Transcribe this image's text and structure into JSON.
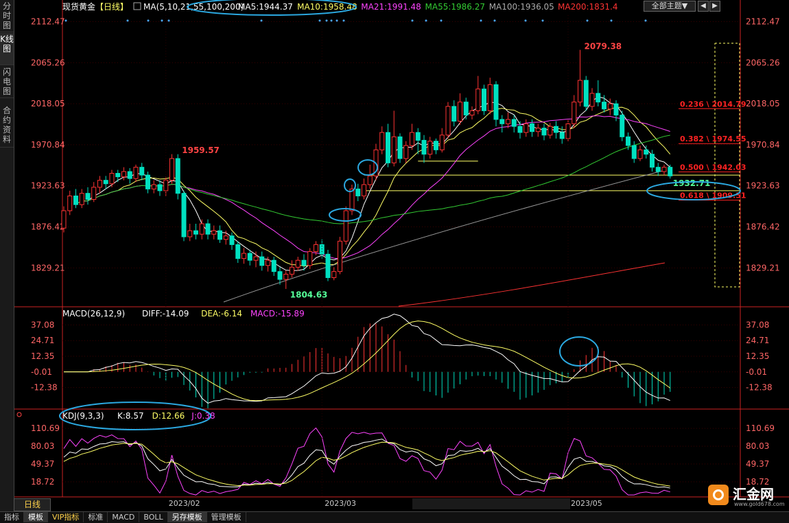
{
  "sidebar": {
    "tabs": [
      "分时图",
      "K线图",
      "闪电图",
      "合约资料"
    ]
  },
  "header": {
    "instrument": "现货黄金",
    "period": "【日线】",
    "ma_label": "MA(5,10,21,55,100,200)",
    "ma_values": [
      {
        "text": "MA5:1944.37",
        "color": "#ffffff"
      },
      {
        "text": "MA10:1958.48",
        "color": "#ffff66"
      },
      {
        "text": "MA21:1991.48",
        "color": "#ff44ff"
      },
      {
        "text": "MA55:1986.27",
        "color": "#33cc33"
      },
      {
        "text": "MA100:1936.05",
        "color": "#aaaaaa"
      },
      {
        "text": "MA200:1831.4",
        "color": "#ff3333"
      }
    ],
    "theme_button": "全部主题▼",
    "prev": "◀",
    "next": "▶"
  },
  "colors": {
    "up": "#ff3333",
    "down": "#00e0c0",
    "grid": "#3a0000",
    "axis": "#cc2222",
    "fib": "#ff2222"
  },
  "chart_data": {
    "type": "candlestick",
    "price_axis": [
      "2112.47",
      "2065.26",
      "2018.05",
      "1970.84",
      "1923.63",
      "1876.42",
      "1829.21"
    ],
    "x_ticks": [
      "2023/02",
      "2023/03",
      "2023/05"
    ],
    "price_range": [
      1790,
      2120
    ],
    "candles": [
      [
        1875,
        1895,
        1870,
        1900
      ],
      [
        1895,
        1912,
        1890,
        1918
      ],
      [
        1912,
        1902,
        1898,
        1920
      ],
      [
        1902,
        1915,
        1898,
        1920
      ],
      [
        1915,
        1908,
        1902,
        1922
      ],
      [
        1908,
        1922,
        1905,
        1928
      ],
      [
        1922,
        1930,
        1915,
        1935
      ],
      [
        1930,
        1926,
        1920,
        1935
      ],
      [
        1926,
        1938,
        1922,
        1942
      ],
      [
        1938,
        1934,
        1928,
        1942
      ],
      [
        1934,
        1940,
        1930,
        1945
      ],
      [
        1940,
        1932,
        1926,
        1944
      ],
      [
        1932,
        1945,
        1928,
        1948
      ],
      [
        1945,
        1936,
        1930,
        1950
      ],
      [
        1936,
        1920,
        1915,
        1940
      ],
      [
        1920,
        1925,
        1915,
        1930
      ],
      [
        1925,
        1918,
        1912,
        1930
      ],
      [
        1918,
        1930,
        1912,
        1934
      ],
      [
        1930,
        1955,
        1926,
        1960
      ],
      [
        1955,
        1915,
        1908,
        1960
      ],
      [
        1915,
        1865,
        1860,
        1918
      ],
      [
        1865,
        1872,
        1860,
        1880
      ],
      [
        1872,
        1868,
        1862,
        1880
      ],
      [
        1868,
        1880,
        1862,
        1885
      ],
      [
        1880,
        1868,
        1862,
        1885
      ],
      [
        1868,
        1872,
        1862,
        1878
      ],
      [
        1872,
        1862,
        1858,
        1878
      ],
      [
        1862,
        1866,
        1856,
        1872
      ],
      [
        1866,
        1856,
        1850,
        1870
      ],
      [
        1856,
        1840,
        1835,
        1860
      ],
      [
        1840,
        1846,
        1834,
        1852
      ],
      [
        1846,
        1838,
        1832,
        1850
      ],
      [
        1838,
        1842,
        1830,
        1848
      ],
      [
        1842,
        1832,
        1826,
        1848
      ],
      [
        1832,
        1838,
        1825,
        1842
      ],
      [
        1838,
        1825,
        1820,
        1842
      ],
      [
        1825,
        1816,
        1810,
        1830
      ],
      [
        1816,
        1822,
        1805,
        1826
      ],
      [
        1822,
        1830,
        1818,
        1838
      ],
      [
        1830,
        1838,
        1826,
        1842
      ],
      [
        1838,
        1832,
        1826,
        1845
      ],
      [
        1832,
        1848,
        1828,
        1852
      ],
      [
        1848,
        1856,
        1844,
        1860
      ],
      [
        1856,
        1845,
        1840,
        1862
      ],
      [
        1845,
        1818,
        1814,
        1850
      ],
      [
        1818,
        1825,
        1815,
        1830
      ],
      [
        1825,
        1860,
        1822,
        1865
      ],
      [
        1860,
        1895,
        1856,
        1900
      ],
      [
        1895,
        1920,
        1890,
        1925
      ],
      [
        1920,
        1912,
        1906,
        1926
      ],
      [
        1912,
        1925,
        1908,
        1932
      ],
      [
        1925,
        1935,
        1920,
        1948
      ],
      [
        1935,
        1965,
        1930,
        1972
      ],
      [
        1965,
        1985,
        1960,
        1992
      ],
      [
        1985,
        1950,
        1945,
        1995
      ],
      [
        1950,
        1980,
        1946,
        2010
      ],
      [
        1980,
        1955,
        1950,
        1984
      ],
      [
        1955,
        1970,
        1950,
        1975
      ],
      [
        1970,
        1985,
        1965,
        1995
      ],
      [
        1985,
        1976,
        1960,
        1990
      ],
      [
        1976,
        1960,
        1950,
        1982
      ],
      [
        1960,
        1975,
        1955,
        1980
      ],
      [
        1975,
        1965,
        1960,
        1978
      ],
      [
        1965,
        1982,
        1962,
        1990
      ],
      [
        1982,
        2015,
        1978,
        2020
      ],
      [
        2015,
        1998,
        1992,
        2022
      ],
      [
        1998,
        2020,
        1994,
        2030
      ],
      [
        2020,
        2005,
        2000,
        2025
      ],
      [
        2005,
        2010,
        2000,
        2015
      ],
      [
        2010,
        2035,
        2006,
        2050
      ],
      [
        2035,
        2010,
        2005,
        2040
      ],
      [
        2010,
        2040,
        2006,
        2048
      ],
      [
        2040,
        2000,
        1992,
        2044
      ],
      [
        2000,
        1995,
        1985,
        2005
      ],
      [
        1995,
        2000,
        1990,
        2008
      ],
      [
        2000,
        1992,
        1985,
        2005
      ],
      [
        1992,
        1985,
        1978,
        1998
      ],
      [
        1985,
        1995,
        1980,
        2000
      ],
      [
        1995,
        1986,
        1980,
        2000
      ],
      [
        1986,
        1990,
        1980,
        1995
      ],
      [
        1990,
        1982,
        1976,
        1995
      ],
      [
        1982,
        1992,
        1978,
        1996
      ],
      [
        1992,
        1985,
        1978,
        1998
      ],
      [
        1985,
        1978,
        1972,
        1992
      ],
      [
        1978,
        1995,
        1975,
        2000
      ],
      [
        1995,
        2020,
        1990,
        2028
      ],
      [
        2020,
        2045,
        2015,
        2080
      ],
      [
        2045,
        2015,
        2010,
        2050
      ],
      [
        2015,
        2030,
        2010,
        2036
      ],
      [
        2030,
        2020,
        2015,
        2045
      ],
      [
        2020,
        2012,
        2008,
        2028
      ],
      [
        2012,
        2018,
        2005,
        2024
      ],
      [
        2018,
        2005,
        1998,
        2022
      ],
      [
        2005,
        1980,
        1975,
        2010
      ],
      [
        1980,
        1970,
        1965,
        1985
      ],
      [
        1970,
        1955,
        1950,
        1975
      ],
      [
        1955,
        1965,
        1952,
        1970
      ],
      [
        1965,
        1960,
        1955,
        1970
      ],
      [
        1960,
        1945,
        1940,
        1965
      ],
      [
        1945,
        1940,
        1935,
        1950
      ],
      [
        1940,
        1945,
        1936,
        1948
      ],
      [
        1945,
        1935,
        1932,
        1948
      ]
    ],
    "annotations": [
      {
        "text": "1959.57",
        "price": 1959.57,
        "index": 19,
        "color": "#ff4444",
        "dx": 6
      },
      {
        "text": "1804.63",
        "price": 1804.63,
        "index": 37,
        "color": "#55ff99",
        "dx": 6
      },
      {
        "text": "2079.38",
        "price": 2079.38,
        "index": 86,
        "color": "#ff4444",
        "dx": 6
      },
      {
        "text": "1932.71",
        "price": 1932.71,
        "index": 101,
        "color": "#55ff99",
        "dx": 4
      }
    ],
    "fib_levels": [
      {
        "label": "0.236 \\ 2014.79",
        "price": 2014.79
      },
      {
        "label": "0.382 \\ 1974.55",
        "price": 1974.55
      },
      {
        "label": "0.500 \\ 1942.03",
        "price": 1942.03
      },
      {
        "label": "0.618 \\ 1909.51",
        "price": 1909.51
      }
    ],
    "horizontal_lines": [
      1936,
      1918
    ],
    "macd": {
      "label": "MACD(26,12,9)",
      "values": [
        {
          "text": "DIFF:-14.09",
          "color": "#ffffff"
        },
        {
          "text": "DEA:-6.14",
          "color": "#ffff66"
        },
        {
          "text": "MACD:-15.89",
          "color": "#ff44ff"
        }
      ],
      "axis": [
        "37.08",
        "24.71",
        "12.35",
        "-0.01",
        "-12.38"
      ],
      "range": [
        -18,
        40
      ]
    },
    "kdj": {
      "label": "KDJ(9,3,3)",
      "values": [
        {
          "text": "K:8.57",
          "color": "#ffffff"
        },
        {
          "text": "D:12.66",
          "color": "#ffff66"
        },
        {
          "text": "J:0.38",
          "color": "#ff44ff"
        }
      ],
      "axis": [
        "110.69",
        "80.03",
        "49.37",
        "18.72"
      ],
      "range": [
        -5,
        118
      ]
    }
  },
  "bottom_tabs": [
    "指标",
    "模板",
    "VIP指标",
    "标准",
    "MACD",
    "BOLL",
    "另存模板",
    "管理模板"
  ],
  "daily_tab": "日线",
  "logo": {
    "text": "汇金网",
    "url": "www.gold678.com"
  }
}
